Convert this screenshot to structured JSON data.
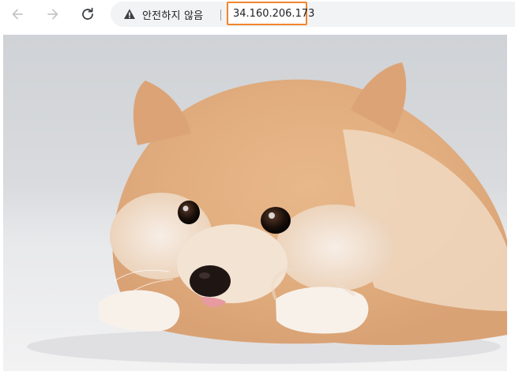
{
  "toolbar": {
    "back_icon": "arrow-left-icon",
    "forward_icon": "arrow-right-icon",
    "reload_icon": "reload-icon"
  },
  "omnibox": {
    "security_icon": "warning-triangle-icon",
    "security_label": "안전하지 않음",
    "url": "34.160.206.173",
    "highlight_color": "#f0852d"
  },
  "page": {
    "image_subject_icon": "pomeranian-dog-photo"
  }
}
